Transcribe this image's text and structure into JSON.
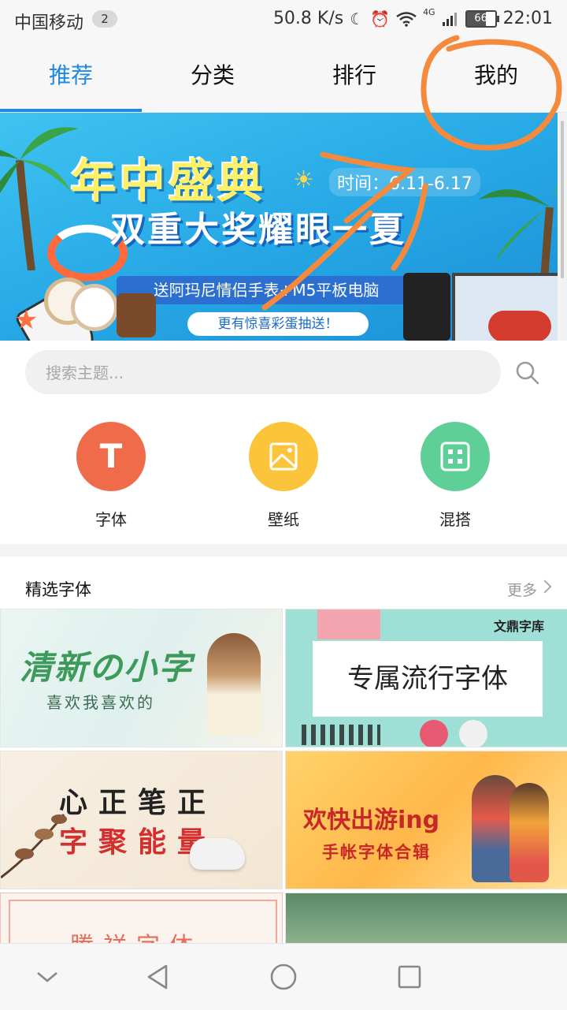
{
  "status_bar": {
    "carrier": "中国移动",
    "notification_count": "2",
    "net_speed": "50.8 K/s",
    "network": "4G",
    "battery": "66",
    "time": "22:01"
  },
  "tabs": [
    {
      "label": "推荐",
      "active": true
    },
    {
      "label": "分类",
      "active": false
    },
    {
      "label": "排行",
      "active": false
    },
    {
      "label": "我的",
      "active": false
    }
  ],
  "banner": {
    "title": "年中盛典",
    "time_text": "时间：6.11-6.17",
    "headline": "双重大奖耀眼一夏",
    "sub": "送阿玛尼情侣手表+M5平板电脑",
    "sub2": "更有惊喜彩蛋抽送！"
  },
  "search": {
    "placeholder": "搜索主题..."
  },
  "categories": [
    {
      "label": "字体",
      "icon": "font-icon",
      "color": "#ef6b4a",
      "glyph": "T"
    },
    {
      "label": "壁纸",
      "icon": "wallpaper-icon",
      "color": "#fbc43a"
    },
    {
      "label": "混搭",
      "icon": "mix-icon",
      "color": "#5fcf98"
    }
  ],
  "section": {
    "title": "精选字体",
    "more": "更多"
  },
  "cards": [
    {
      "title": "清新の小字",
      "sub": "喜欢我喜欢的"
    },
    {
      "title": "专属流行字体",
      "logo": "文鼎字库"
    },
    {
      "line1": "心正笔正",
      "line2": "字聚能量"
    },
    {
      "title": "欢快出游ing",
      "sub": "手帐字体合辑"
    },
    {
      "title": "腾祥字体"
    },
    {
      "title": ""
    }
  ],
  "colors": {
    "accent": "#1e88e5",
    "annotation": "#f58a3c"
  }
}
